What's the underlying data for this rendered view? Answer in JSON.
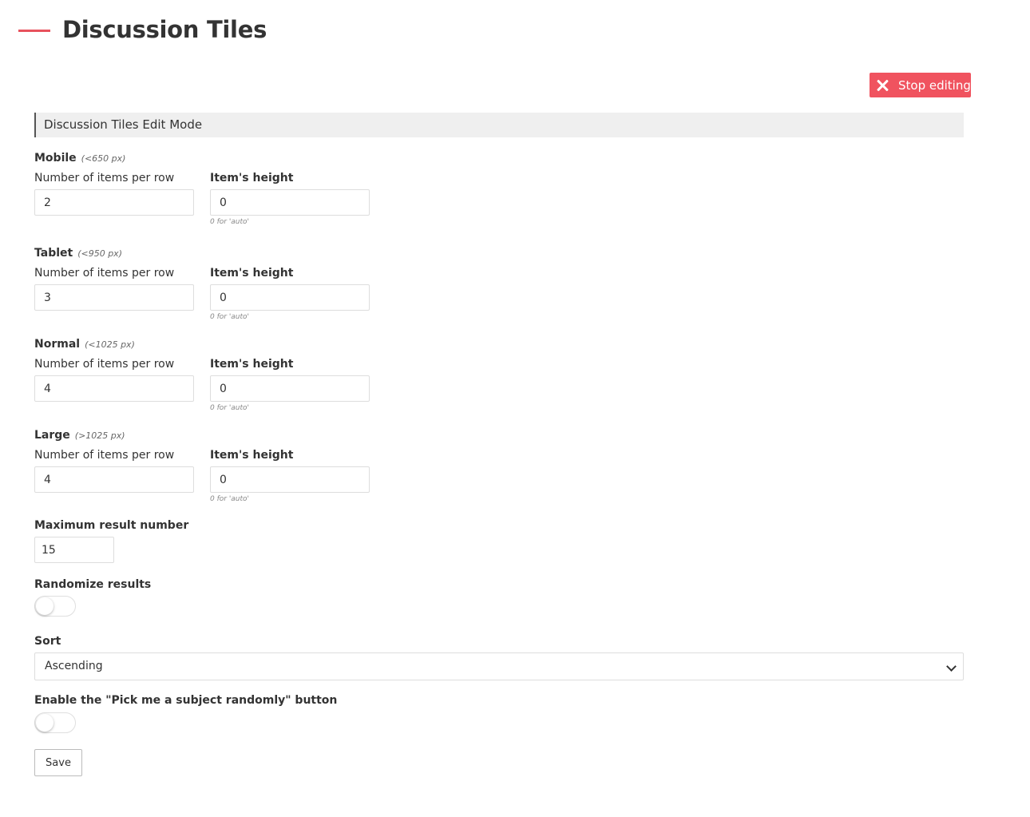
{
  "page": {
    "title": "Discussion Tiles"
  },
  "actions": {
    "stop_editing_label": "Stop editing",
    "save_label": "Save"
  },
  "edit_header": "Discussion Tiles Edit Mode",
  "breakpoints": [
    {
      "name": "Mobile",
      "hint": "(<650 px)",
      "items_label": "Number of items per row",
      "items_value": "2",
      "height_label": "Item's height",
      "height_value": "0",
      "height_help": "0 for 'auto'"
    },
    {
      "name": "Tablet",
      "hint": "(<950 px)",
      "items_label": "Number of items per row",
      "items_value": "3",
      "height_label": "Item's height",
      "height_value": "0",
      "height_help": "0 for 'auto'"
    },
    {
      "name": "Normal",
      "hint": "(<1025 px)",
      "items_label": "Number of items per row",
      "items_value": "4",
      "height_label": "Item's height",
      "height_value": "0",
      "height_help": "0 for 'auto'"
    },
    {
      "name": "Large",
      "hint": "(>1025 px)",
      "items_label": "Number of items per row",
      "items_value": "4",
      "height_label": "Item's height",
      "height_value": "0",
      "height_help": "0 for 'auto'"
    }
  ],
  "max_results": {
    "label": "Maximum result number",
    "value": "15"
  },
  "randomize": {
    "label": "Randomize results",
    "enabled": false
  },
  "sort": {
    "label": "Sort",
    "selected": "Ascending"
  },
  "pick_random": {
    "label": "Enable the \"Pick me a subject randomly\" button",
    "enabled": false
  },
  "colors": {
    "accent": "#f0535f",
    "title_bar": "#e8525d",
    "header_bg": "#efefef"
  },
  "icons": {
    "stop": "close-icon",
    "select": "chevron-down-icon"
  }
}
